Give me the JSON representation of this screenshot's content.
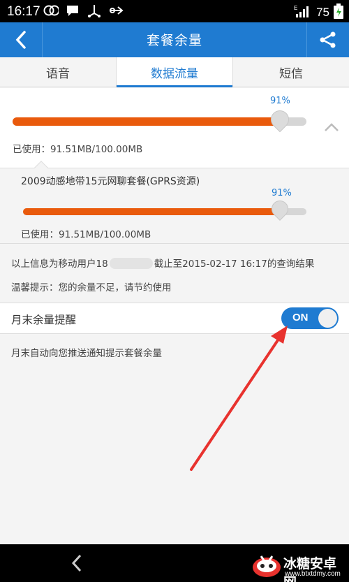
{
  "status_bar": {
    "time": "16:17",
    "icons": [
      "circles-icon",
      "chat-icon",
      "usb-icon",
      "transfer-icon"
    ],
    "battery": "75"
  },
  "app_bar": {
    "title": "套餐余量"
  },
  "tabs": [
    {
      "label": "语音",
      "active": false
    },
    {
      "label": "数据流量",
      "active": true
    },
    {
      "label": "短信",
      "active": false
    }
  ],
  "summary": {
    "percent_text": "91%",
    "progress": 0.91,
    "used_text": "已使用：91.51MB/100.00MB"
  },
  "package": {
    "name": "2009动感地带15元网聊套餐(GPRS资源)",
    "percent_text": "91%",
    "progress": 0.91,
    "used_text": "已使用：91.51MB/100.00MB"
  },
  "info": {
    "query_prefix": "以上信息为移动用户18",
    "query_suffix": "截止至2015-02-17 16:17的查询结果",
    "tip": "温馨提示：您的余量不足，请节约使用"
  },
  "reminder": {
    "label": "月末余量提醒",
    "toggle_text": "ON",
    "enabled": true,
    "description": "月末自动向您推送通知提示套餐余量"
  },
  "watermark": {
    "name": "冰糖安卓网",
    "url": "www.btxtdmy.com"
  },
  "colors": {
    "accent": "#1f7bd1",
    "progress": "#e95a0c",
    "annotation_arrow": "#e8322e"
  }
}
